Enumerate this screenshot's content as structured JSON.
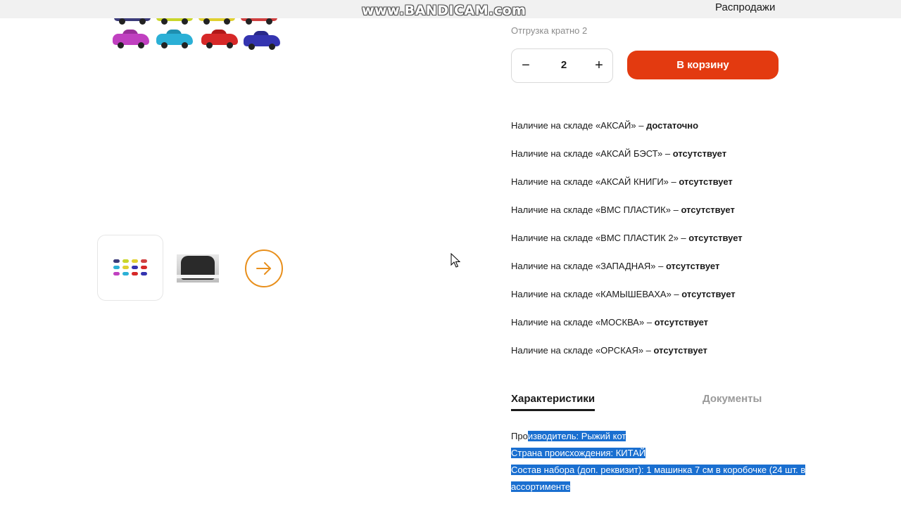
{
  "watermark": "www.BANDICAM.com",
  "header": {
    "sales_link": "Распродажи"
  },
  "purchase": {
    "shipment_note": "Отгрузка кратно 2",
    "quantity": "2",
    "minus_label": "−",
    "plus_label": "+",
    "cart_button": "В корзину"
  },
  "stock": [
    {
      "label": "Наличие на складе «АКСАЙ» – ",
      "status": "достаточно"
    },
    {
      "label": "Наличие на складе «АКСАЙ БЭСТ» – ",
      "status": "отсутствует"
    },
    {
      "label": "Наличие на складе «АКСАЙ КНИГИ» – ",
      "status": "отсутствует"
    },
    {
      "label": "Наличие на складе «ВМС ПЛАСТИК» – ",
      "status": "отсутствует"
    },
    {
      "label": "Наличие на складе «ВМС ПЛАСТИК 2» – ",
      "status": "отсутствует"
    },
    {
      "label": "Наличие на складе «ЗАПАДНАЯ» – ",
      "status": "отсутствует"
    },
    {
      "label": "Наличие на складе «КАМЫШЕВАХА» – ",
      "status": "отсутствует"
    },
    {
      "label": "Наличие на складе «МОСКВА» – ",
      "status": "отсутствует"
    },
    {
      "label": "Наличие на складе «ОРСКАЯ» – ",
      "status": "отсутствует"
    }
  ],
  "tabs": {
    "characteristics": "Характеристики",
    "documents": "Документы"
  },
  "specs": {
    "manufacturer_prefix": "Про",
    "manufacturer_rest": "изводитель: Рыжий кот",
    "country": "Страна происхождения: КИТАЙ",
    "set_line1": "Состав набора (доп. реквизит): 1 машинка 7 см в коробочке (24 шт. в",
    "set_line2": "ассортименте"
  },
  "colors": {
    "accent": "#e33a10",
    "arrow": "#e88f1c",
    "selection": "#1a6fd0"
  },
  "icons": {
    "next": "arrow-right-icon",
    "cursor": "mouse-pointer-icon"
  }
}
